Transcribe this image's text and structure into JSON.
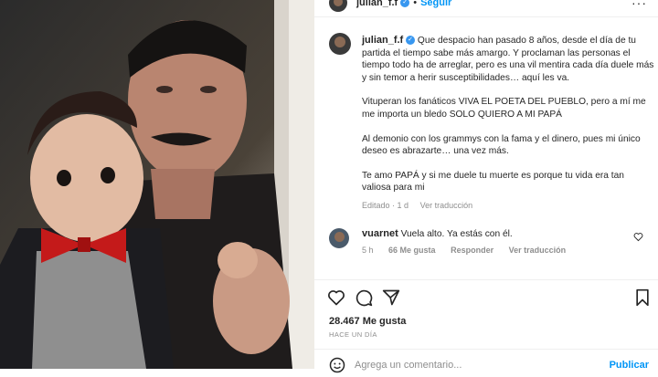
{
  "post": {
    "author": "julian_f.f",
    "follow_label": "Seguir",
    "caption_first": "Que despacio han pasado 8 años, desde el día de tu partida el tiempo sabe más amargo. Y proclaman las personas el tiempo todo ha de arreglar, pero es una vil mentira cada día duele más y sin temor a herir susceptibilidades… aquí les va.",
    "caption_p2": "Vituperan los fanáticos VIVA EL POETA DEL PUEBLO, pero a mí me me importa un bledo SOLO QUIERO A MI PAPÁ",
    "caption_p3": "Al demonio con los grammys con la fama y el dinero, pues mi único deseo es abrazarte… una vez más.",
    "caption_p4": "Te amo PAPÁ y si me duele tu muerte es porque tu vida era tan valiosa para mi",
    "edited": "Editado · 1 d",
    "see_translation": "Ver traducción"
  },
  "comment": {
    "user": "vuarnet",
    "text": "Vuela alto. Ya estás con él.",
    "age": "5 h",
    "likes": "66 Me gusta",
    "reply": "Responder",
    "translate": "Ver traducción"
  },
  "stats": {
    "likes": "28.467 Me gusta",
    "when": "HACE UN DÍA"
  },
  "composer": {
    "placeholder": "Agrega un comentario...",
    "publish": "Publicar"
  },
  "colors": {
    "accent": "#0095f6",
    "verified": "#3897f0",
    "muted": "#8e8e8e"
  },
  "icons": [
    "more-icon",
    "heart-icon",
    "comment-icon",
    "share-icon",
    "save-icon",
    "emoji-icon",
    "verified-icon"
  ]
}
